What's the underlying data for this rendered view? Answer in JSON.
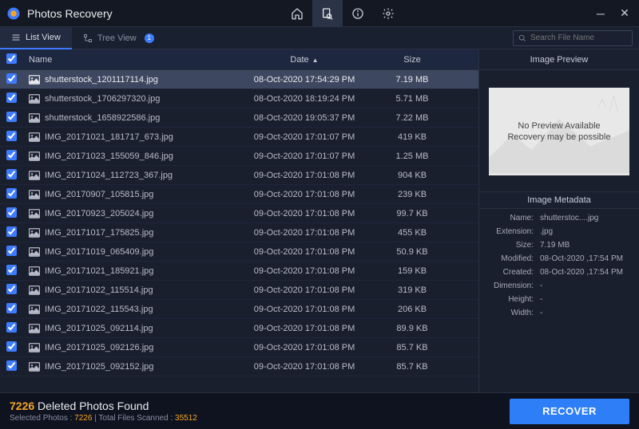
{
  "app_title": "Photos Recovery",
  "viewbar": {
    "list_view": "List View",
    "tree_view": "Tree View",
    "tree_badge": "1"
  },
  "search": {
    "placeholder": "Search File Name"
  },
  "columns": {
    "name": "Name",
    "date": "Date",
    "size": "Size"
  },
  "rows": [
    {
      "name": "shutterstock_1201117114.jpg",
      "date": "08-Oct-2020 17:54:29 PM",
      "size": "7.19 MB",
      "selected": true
    },
    {
      "name": "shutterstock_1706297320.jpg",
      "date": "08-Oct-2020 18:19:24 PM",
      "size": "5.71 MB"
    },
    {
      "name": "shutterstock_1658922586.jpg",
      "date": "08-Oct-2020 19:05:37 PM",
      "size": "7.22 MB"
    },
    {
      "name": "IMG_20171021_181717_673.jpg",
      "date": "09-Oct-2020 17:01:07 PM",
      "size": "419 KB"
    },
    {
      "name": "IMG_20171023_155059_846.jpg",
      "date": "09-Oct-2020 17:01:07 PM",
      "size": "1.25 MB"
    },
    {
      "name": "IMG_20171024_112723_367.jpg",
      "date": "09-Oct-2020 17:01:08 PM",
      "size": "904 KB"
    },
    {
      "name": "IMG_20170907_105815.jpg",
      "date": "09-Oct-2020 17:01:08 PM",
      "size": "239 KB"
    },
    {
      "name": "IMG_20170923_205024.jpg",
      "date": "09-Oct-2020 17:01:08 PM",
      "size": "99.7 KB"
    },
    {
      "name": "IMG_20171017_175825.jpg",
      "date": "09-Oct-2020 17:01:08 PM",
      "size": "455 KB"
    },
    {
      "name": "IMG_20171019_065409.jpg",
      "date": "09-Oct-2020 17:01:08 PM",
      "size": "50.9 KB"
    },
    {
      "name": "IMG_20171021_185921.jpg",
      "date": "09-Oct-2020 17:01:08 PM",
      "size": "159 KB"
    },
    {
      "name": "IMG_20171022_115514.jpg",
      "date": "09-Oct-2020 17:01:08 PM",
      "size": "319 KB"
    },
    {
      "name": "IMG_20171022_115543.jpg",
      "date": "09-Oct-2020 17:01:08 PM",
      "size": "206 KB"
    },
    {
      "name": "IMG_20171025_092114.jpg",
      "date": "09-Oct-2020 17:01:08 PM",
      "size": "89.9 KB"
    },
    {
      "name": "IMG_20171025_092126.jpg",
      "date": "09-Oct-2020 17:01:08 PM",
      "size": "85.7 KB"
    },
    {
      "name": "IMG_20171025_092152.jpg",
      "date": "09-Oct-2020 17:01:08 PM",
      "size": "85.7 KB"
    }
  ],
  "preview": {
    "title": "Image Preview",
    "line1": "No Preview Available",
    "line2": "Recovery may be possible"
  },
  "metadata": {
    "title": "Image Metadata",
    "items": {
      "name_k": "Name:",
      "name_v": "shutterstoc....jpg",
      "ext_k": "Extension:",
      "ext_v": ".jpg",
      "size_k": "Size:",
      "size_v": "7.19 MB",
      "mod_k": "Modified:",
      "mod_v": "08-Oct-2020 ,17:54 PM",
      "cre_k": "Created:",
      "cre_v": "08-Oct-2020 ,17:54 PM",
      "dim_k": "Dimension:",
      "dim_v": "-",
      "h_k": "Height:",
      "h_v": "-",
      "w_k": "Width:",
      "w_v": "-"
    }
  },
  "footer": {
    "count": "7226",
    "found_label": "Deleted Photos Found",
    "selected_label": "Selected Photos :",
    "selected_v": "7226",
    "scanned_label": "| Total Files Scanned :",
    "scanned_v": "35512",
    "recover": "RECOVER"
  }
}
